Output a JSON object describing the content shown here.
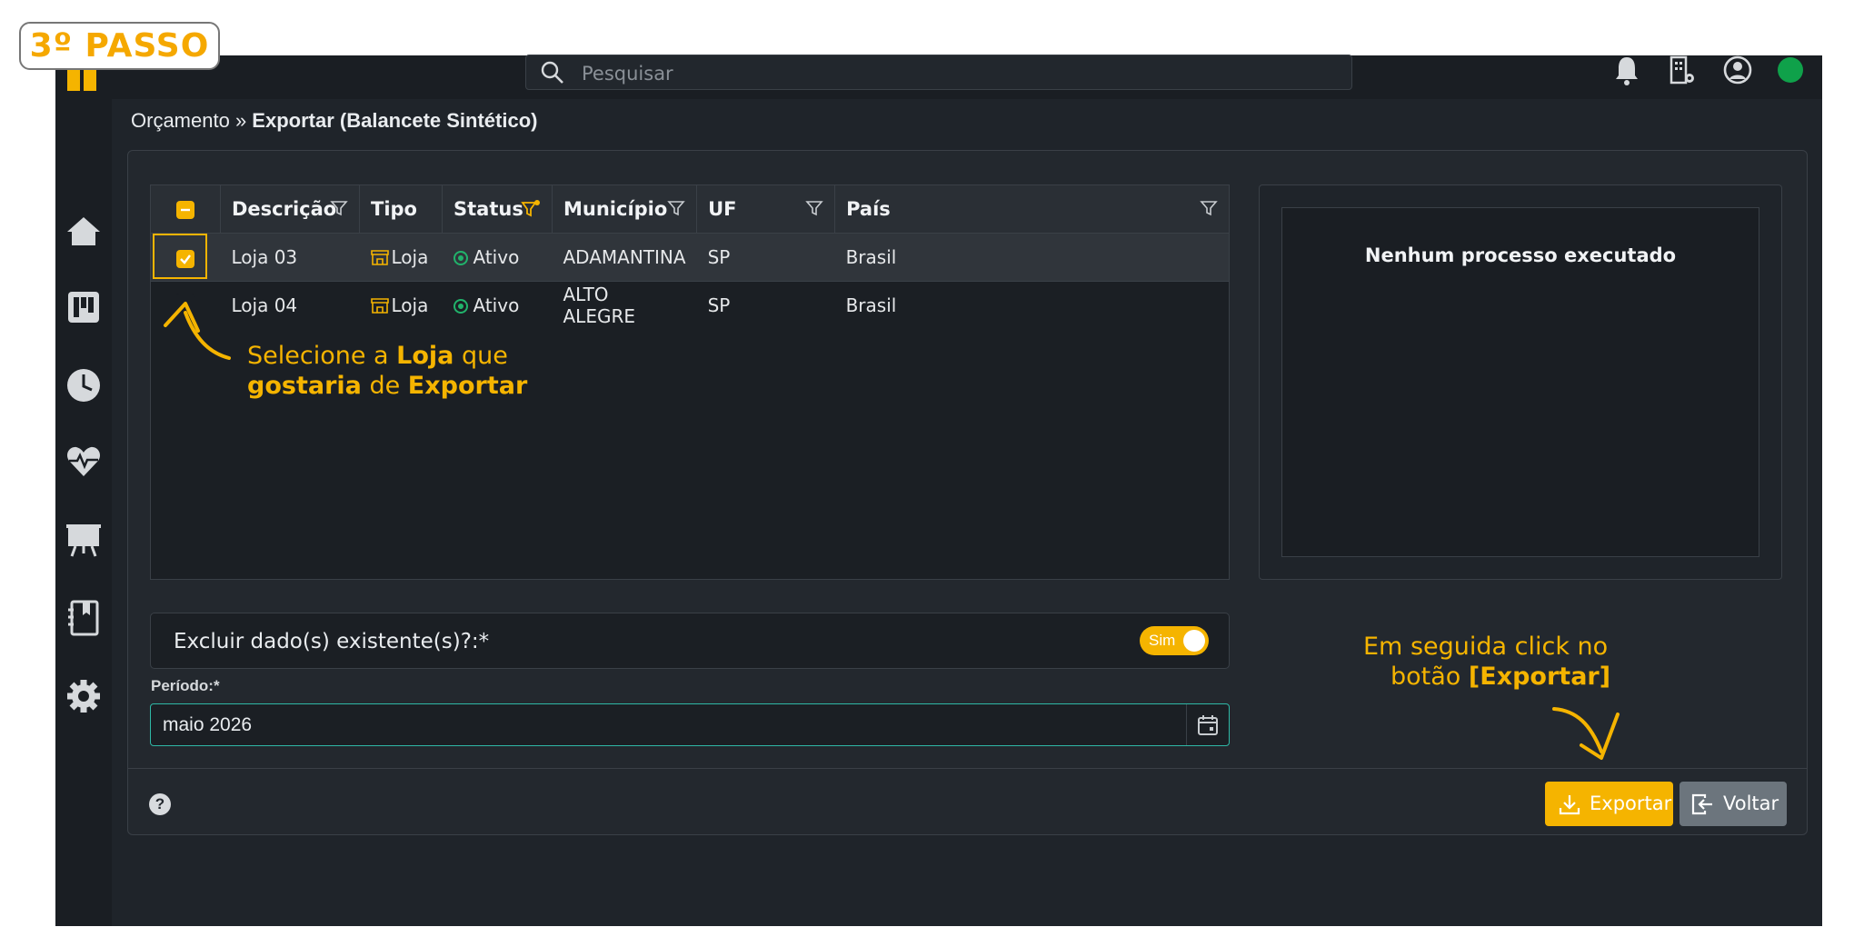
{
  "badge": "3º PASSO",
  "search": {
    "placeholder": "Pesquisar"
  },
  "breadcrumb": {
    "parent": "Orçamento",
    "separator": " » ",
    "current": "Exportar (Balancete Sintético)"
  },
  "table": {
    "columns": [
      "Descrição",
      "Tipo",
      "Status",
      "Município",
      "UF",
      "País"
    ],
    "rows": [
      {
        "descricao": "Loja 03",
        "tipo": "Loja",
        "status": "Ativo",
        "municipio": "ADAMANTINA",
        "uf": "SP",
        "pais": "Brasil"
      },
      {
        "descricao": "Loja 04",
        "tipo": "Loja",
        "status": "Ativo",
        "municipio": "ALTO ALEGRE",
        "uf": "SP",
        "pais": "Brasil"
      }
    ]
  },
  "panel": {
    "message": "Nenhum processo executado"
  },
  "excluir": {
    "label": "Excluir dado(s) existente(s)?:*",
    "toggle": "Sim"
  },
  "periodo": {
    "label": "Período:*",
    "value": "maio 2026"
  },
  "buttons": {
    "exportar": "Exportar",
    "voltar": "Voltar",
    "help": "?"
  },
  "annotations": {
    "a1_pre": "Selecione a ",
    "a1_b1": "Loja",
    "a1_mid": " que",
    "a1_b2": "gostaria",
    "a1_mid2": " de ",
    "a1_b3": "Exportar",
    "a2_line1": "Em seguida click no",
    "a2_pre": "botão ",
    "a2_b": "[Exportar]"
  },
  "colors": {
    "accent": "#f5b400",
    "status_active": "#21b36b",
    "online": "#0fa14a"
  }
}
